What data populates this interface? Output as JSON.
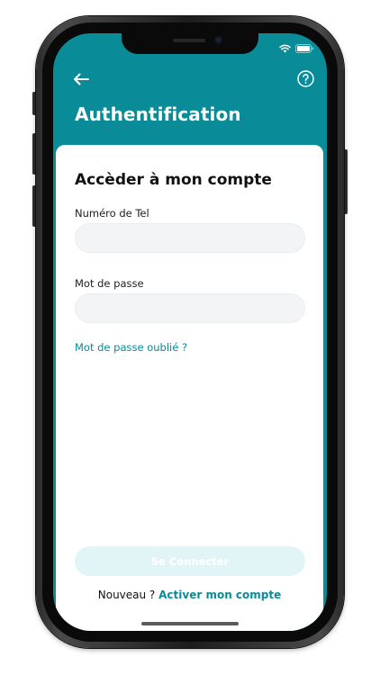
{
  "header": {
    "title": "Authentification"
  },
  "form": {
    "title": "Accèder à mon compte",
    "phone_label": "Numéro de Tel",
    "phone_value": "",
    "phone_placeholder": "",
    "password_label": "Mot de passe",
    "password_value": "",
    "password_placeholder": "",
    "forgot_link": "Mot de passe oublié ?",
    "connect_button": "Se Connecter"
  },
  "signup": {
    "prompt": "Nouveau ?",
    "link": "Activer mon compte"
  },
  "icons": {
    "back": "arrow-left-icon",
    "help": "question-circle-icon",
    "wifi": "wifi-icon",
    "battery": "battery-icon"
  },
  "colors": {
    "accent": "#0a8b98",
    "button_disabled_bg": "#e2f5f6",
    "input_bg": "#f3f4f5",
    "card_bg": "#ffffff"
  }
}
